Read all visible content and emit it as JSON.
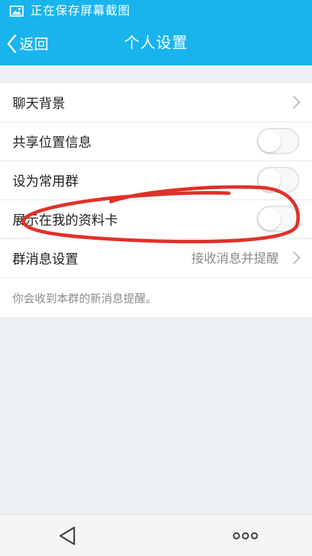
{
  "status_bar": {
    "notification_icon": "image-icon",
    "text": "正在保存屏幕截图"
  },
  "nav": {
    "back_label": "返回",
    "back_icon": "chevron-left-icon",
    "title": "个人设置"
  },
  "settings": {
    "rows": [
      {
        "label": "聊天背景",
        "type": "link"
      },
      {
        "label": "共享位置信息",
        "type": "toggle",
        "on": false
      },
      {
        "label": "设为常用群",
        "type": "toggle",
        "on": false
      },
      {
        "label": "展示在我的资料卡",
        "type": "toggle",
        "on": false
      },
      {
        "label": "群消息设置",
        "type": "link",
        "value": "接收消息并提醒"
      }
    ],
    "hint": "你会收到本群的新消息提醒。"
  },
  "annotation": {
    "shape": "hand-drawn-ellipse",
    "color": "#e0312a"
  },
  "bottom_nav": {
    "back_icon": "triangle-back-icon",
    "more_icon": "more-dots-icon"
  },
  "colors": {
    "accent": "#18b4ed",
    "background": "#edf1f5"
  }
}
